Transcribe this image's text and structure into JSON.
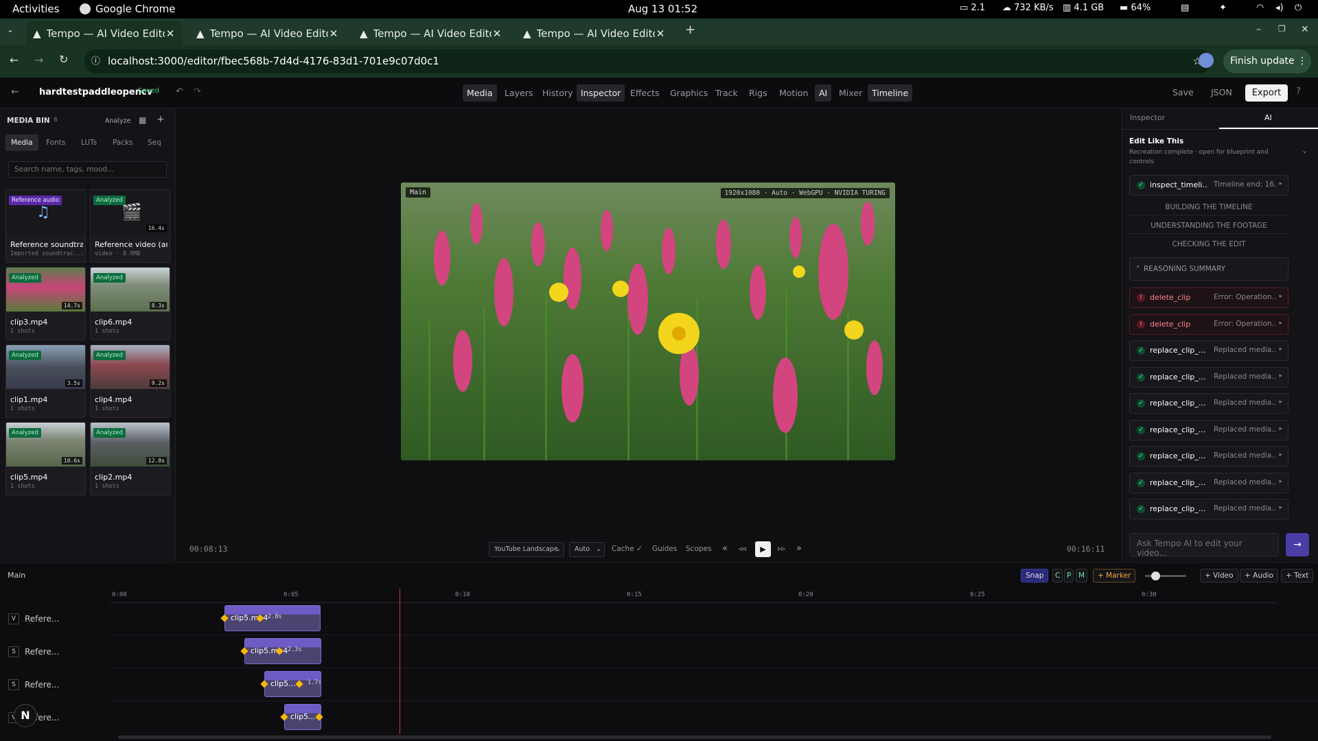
{
  "system": {
    "activities": "Activities",
    "app": "Google Chrome",
    "datetime": "Aug 13  01:52",
    "displays": "2.1",
    "net": "732 KB/s",
    "mem": "4.1 GB",
    "battery": "64%"
  },
  "browser": {
    "tabs": [
      {
        "title": "Tempo — AI Video Editor"
      },
      {
        "title": "Tempo — AI Video Editor"
      },
      {
        "title": "Tempo — AI Video Editor"
      },
      {
        "title": "Tempo — AI Video Editor"
      }
    ],
    "url": "localhost:3000/editor/fbec568b-7d4d-4176-83d1-701e9c07d0c1",
    "finish_update": "Finish update"
  },
  "header": {
    "project": "hardtestpaddleopencv",
    "saved": "Saved",
    "nav": [
      "Media",
      "Layers",
      "History",
      "Inspector",
      "Effects",
      "Graphics",
      "Track",
      "Rigs",
      "Motion",
      "AI",
      "Mixer",
      "Timeline"
    ],
    "save": "Save",
    "json": "JSON",
    "export": "Export"
  },
  "media_bin": {
    "title": "MEDIA BIN",
    "count": "8",
    "analyze": "Analyze",
    "tabs": [
      "Media",
      "Fonts",
      "LUTs",
      "Packs",
      "Seq"
    ],
    "search_placeholder": "Search name, tags, mood...",
    "items": [
      {
        "badge": "Reference audio",
        "name": "Reference soundtra...",
        "sub": "Imported soundtrac...",
        "duration": ""
      },
      {
        "badge": "Analyzed",
        "name": "Reference video (an...",
        "sub": "video · 8.9MB",
        "duration": "16.4s"
      },
      {
        "badge": "Analyzed",
        "name": "clip3.mp4",
        "sub": "1 shots",
        "duration": "14.7s"
      },
      {
        "badge": "Analyzed",
        "name": "clip6.mp4",
        "sub": "1 shots",
        "duration": "8.3s"
      },
      {
        "badge": "Analyzed",
        "name": "clip1.mp4",
        "sub": "1 shots",
        "duration": "3.5s"
      },
      {
        "badge": "Analyzed",
        "name": "clip4.mp4",
        "sub": "1 shots",
        "duration": "9.2s"
      },
      {
        "badge": "Analyzed",
        "name": "clip5.mp4",
        "sub": "1 shots",
        "duration": "10.6s"
      },
      {
        "badge": "Analyzed",
        "name": "clip2.mp4",
        "sub": "1 shots",
        "duration": "12.8s"
      }
    ]
  },
  "preview": {
    "label": "Main",
    "info": "1920x1080 · Auto · WebGPU · NVIDIA TURING",
    "time_current": "00:08:13",
    "time_total": "00:16:11",
    "format": "YouTube Landscape",
    "quality": "Auto",
    "cache": "Cache ✓",
    "guides": "Guides",
    "scopes": "Scopes"
  },
  "ai_panel": {
    "tabs": [
      "Inspector",
      "AI"
    ],
    "title": "Edit Like This",
    "subtitle": "Recreation complete · open for blueprint and controls",
    "first": {
      "name": "inspect_timeli...",
      "status": "Timeline end: 16..."
    },
    "sections": [
      "BUILDING THE TIMELINE",
      "UNDERSTANDING THE FOOTAGE",
      "CHECKING THE EDIT"
    ],
    "reasoning": "REASONING SUMMARY",
    "rows": [
      {
        "name": "delete_clip",
        "status": "Error: Operation..."
      },
      {
        "name": "delete_clip",
        "status": "Error: Operation..."
      },
      {
        "name": "replace_clip_...",
        "status": "Replaced media..."
      },
      {
        "name": "replace_clip_...",
        "status": "Replaced media..."
      },
      {
        "name": "replace_clip_...",
        "status": "Replaced media..."
      },
      {
        "name": "replace_clip_...",
        "status": "Replaced media..."
      },
      {
        "name": "replace_clip_...",
        "status": "Replaced media..."
      },
      {
        "name": "replace_clip_...",
        "status": "Replaced media..."
      },
      {
        "name": "replace_clip_...",
        "status": "Replaced media..."
      }
    ],
    "input_placeholder": "Ask Tempo AI to edit your video..."
  },
  "timeline": {
    "label": "Main",
    "snap": "Snap",
    "cpm": [
      "C",
      "P",
      "M"
    ],
    "marker": "+ Marker",
    "add_video": "+ Video",
    "add_audio": "+ Audio",
    "add_text": "+ Text",
    "ticks": [
      "0:00",
      "0:05",
      "0:10",
      "0:15",
      "0:20",
      "0:25",
      "0:30"
    ],
    "tracks": [
      {
        "tag": "V",
        "name": "Refere..."
      },
      {
        "tag": "S",
        "name": "Refere..."
      },
      {
        "tag": "S",
        "name": "Refere..."
      },
      {
        "tag": "V",
        "name": "Refere..."
      }
    ],
    "clips": [
      {
        "label": "clip5.mp4",
        "dur": "2.8s"
      },
      {
        "label": "clip5.mp4",
        "dur": "2.3s"
      },
      {
        "label": "clip5...",
        "dur": "1.7s"
      },
      {
        "label": "clip5...",
        "dur": ""
      }
    ]
  }
}
